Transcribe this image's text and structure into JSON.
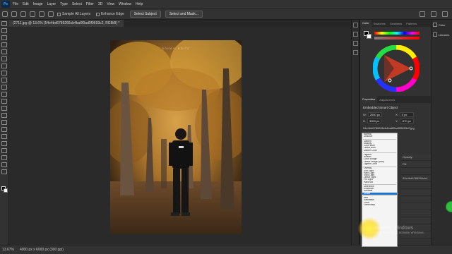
{
  "menubar": {
    "logo": "Ps",
    "items": [
      "File",
      "Edit",
      "Image",
      "Layer",
      "Type",
      "Select",
      "Filter",
      "3D",
      "View",
      "Window",
      "Help"
    ]
  },
  "options": {
    "sample_all_layers": "Sample All Layers",
    "enhance_edge": "Enhance Edge",
    "select_subject": "Select Subject",
    "select_and_mask": "Select and Mask..."
  },
  "document": {
    "tab_title": "(2711.jpg @ 13.6% (54e4bd6786266cb4ba6f0ad0f9693c2, RGB/8) *",
    "zoom": "13.67%",
    "doc_size": "4000 px x 6000 px (300 ppi)"
  },
  "panel": {
    "color_tabs": [
      "Color",
      "Swatches",
      "Gradients",
      "Patterns"
    ],
    "properties_tabs": [
      "Properties",
      "Adjustments"
    ],
    "properties_title": "Embedded Smart Object",
    "w_label": "W:",
    "w_value": "2000 px",
    "h_label": "H:",
    "h_value": "3000 px",
    "x_label": "X:",
    "x_value": "0 px",
    "y_label": "Y:",
    "y_value": "-970 px",
    "filename": "54e4bd6786266cb4ba6f0ad0f9693c2.jpg"
  },
  "libraries": [
    "Color",
    "Libraries"
  ],
  "blend_modes": [
    "Normal",
    "Dissolve",
    "-",
    "Darken",
    "Multiply",
    "Color Burn",
    "Linear Burn",
    "Darker Color",
    "-",
    "Lighten",
    "Screen",
    "Color Dodge",
    "Linear Dodge (Add)",
    "Lighter Color",
    "-",
    "Overlay",
    "Soft Light",
    "Hard Light",
    "Vivid Light",
    "Linear Light",
    "Pin Light",
    "Hard Mix",
    "-",
    "Difference",
    "Exclusion",
    "Subtract",
    "Divide",
    "-",
    "Hue",
    "Saturation",
    "Color",
    "Luminosity"
  ],
  "blend_selected": "Divide",
  "layer_rows": [
    "Opacity:",
    "Fill:",
    "",
    "54e4bd6786266cb4",
    "",
    "",
    "",
    "",
    "",
    "",
    "",
    "",
    ""
  ],
  "watermark": {
    "line1": "Activate Windows",
    "line2": "Go to Settings to activate Windows."
  },
  "photo_watermark": "SOHAIL EDITZ",
  "colors": {
    "menubar": "#323232",
    "canvas": "#2a2a2a",
    "accent": "#1e6fd6",
    "highlight": "#ffe83c",
    "green": "#2fbf3f"
  }
}
